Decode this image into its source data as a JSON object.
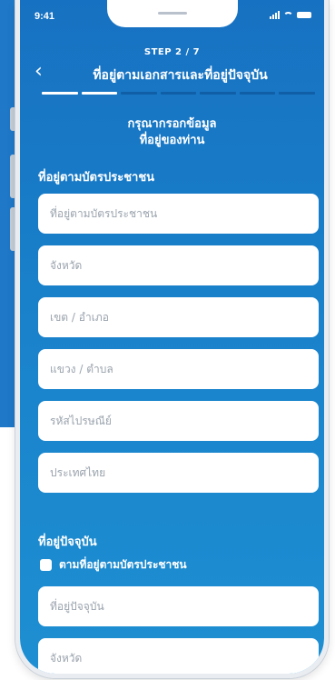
{
  "status": {
    "time": "9:41"
  },
  "header": {
    "step": "STEP 2 / 7",
    "title": "ที่อยู่ตามเอกสารและที่อยู่ปัจจุบัน",
    "progress": {
      "completed": 2,
      "total": 7
    }
  },
  "intro": {
    "line1": "กรุณากรอกข้อมูล",
    "line2": "ที่อยู่ของท่าน"
  },
  "id_card_address": {
    "heading": "ที่อยู่ตามบัตรประชาชน",
    "fields": [
      "ที่อยู่ตามบัตรประชาชน",
      "จังหวัด",
      "เขต / อำเภอ",
      "แขวง / ตำบล",
      "รหัสไปรษณีย์",
      "ประเทศไทย"
    ]
  },
  "current_address": {
    "heading": "ที่อยู่ปัจจุบัน",
    "same_as_checkbox": "ตามที่อยู่ตามบัตรประชาชน",
    "fields": [
      "ที่อยู่ปัจจุบัน",
      "จังหวัด"
    ]
  }
}
